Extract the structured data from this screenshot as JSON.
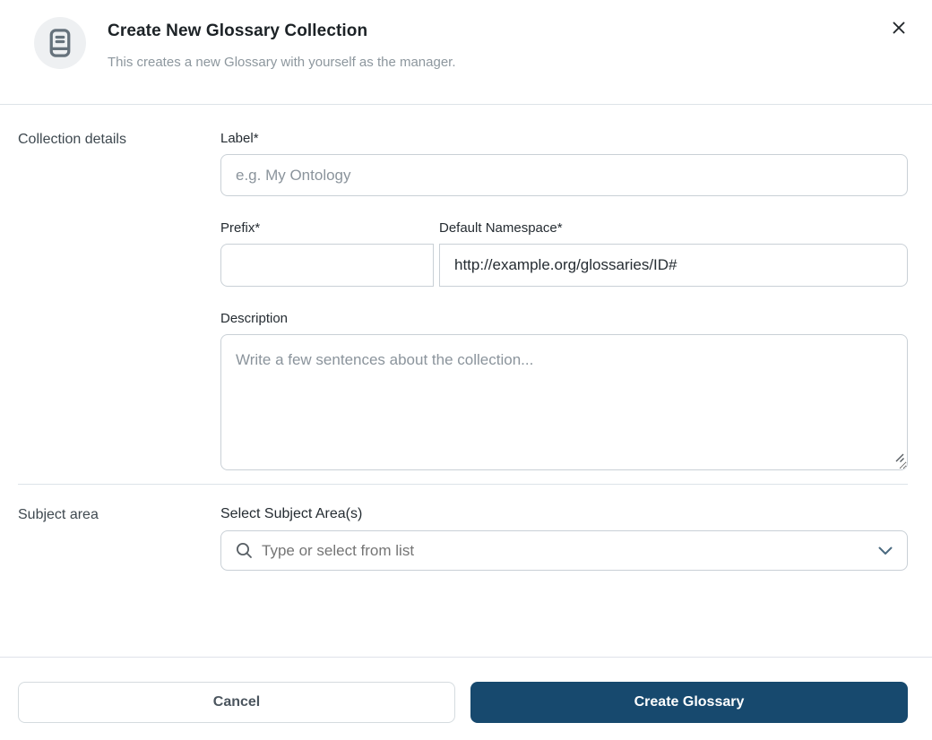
{
  "header": {
    "title": "Create New Glossary Collection",
    "subtitle": "This creates a new Glossary with yourself as the manager.",
    "icon": "journal-icon",
    "close_icon": "close-icon"
  },
  "form": {
    "collection_section_label": "Collection details",
    "label_field": {
      "label": "Label*",
      "value": "",
      "placeholder": "e.g. My Ontology"
    },
    "prefix_field": {
      "label": "Prefix*",
      "value": "",
      "placeholder": ""
    },
    "namespace_field": {
      "label": "Default Namespace*",
      "value": "http://example.org/glossaries/ID#"
    },
    "description_field": {
      "label": "Description",
      "value": "",
      "placeholder": "Write a few sentences about the collection..."
    },
    "subject_section_label": "Subject area",
    "subject_field": {
      "label": "Select Subject Area(s)",
      "value": "",
      "placeholder": "Type or select from list",
      "icons": [
        "search-icon",
        "chevron-down-icon"
      ]
    }
  },
  "footer": {
    "cancel_label": "Cancel",
    "create_label": "Create Glossary"
  },
  "colors": {
    "accent": "#17496e",
    "border": "#c9d0d6",
    "divider": "#dde3e8",
    "muted_text": "#8d979e",
    "icon_gray": "#66727c",
    "title_text": "#1c2226"
  }
}
